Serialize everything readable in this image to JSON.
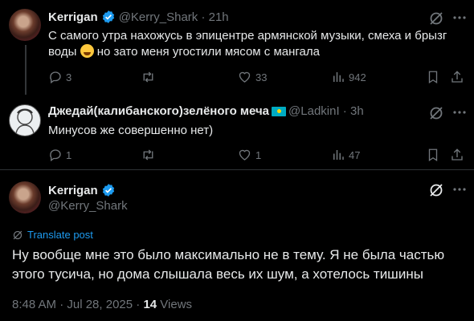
{
  "reply1": {
    "author_name": "Kerrigan",
    "author_handle": "@Kerry_Shark",
    "time": "21h",
    "text_a": "С самого утра нахожусь в эпицентре армянской музыки, смеха и брызг воды",
    "text_b": "но зато меня угостили мясом с мангала",
    "replies": "3",
    "reposts": "",
    "likes": "33",
    "views": "942"
  },
  "reply2": {
    "author_name": "Джедай(калибанского)зелёного меча",
    "author_handle": "@LadkinI",
    "time": "3h",
    "text": "Минусов же совершенно нет)",
    "replies": "1",
    "reposts": "",
    "likes": "1",
    "views": "47"
  },
  "main": {
    "author_name": "Kerrigan",
    "author_handle": "@Kerry_Shark",
    "translate_label": "Translate post",
    "text": "Ну вообще мне это было максимально не в тему. Я не была частью этого тусича, но дома слышала весь их шум, а хотелось тишины",
    "timestamp": "8:48 AM · Jul 28, 2025 ·",
    "views_count": "14",
    "views_label": "Views"
  },
  "colors": {
    "accent": "#1d9bf0",
    "muted": "#71767b",
    "text": "#e7e9ea",
    "background": "#000000",
    "divider": "#2f3336"
  }
}
